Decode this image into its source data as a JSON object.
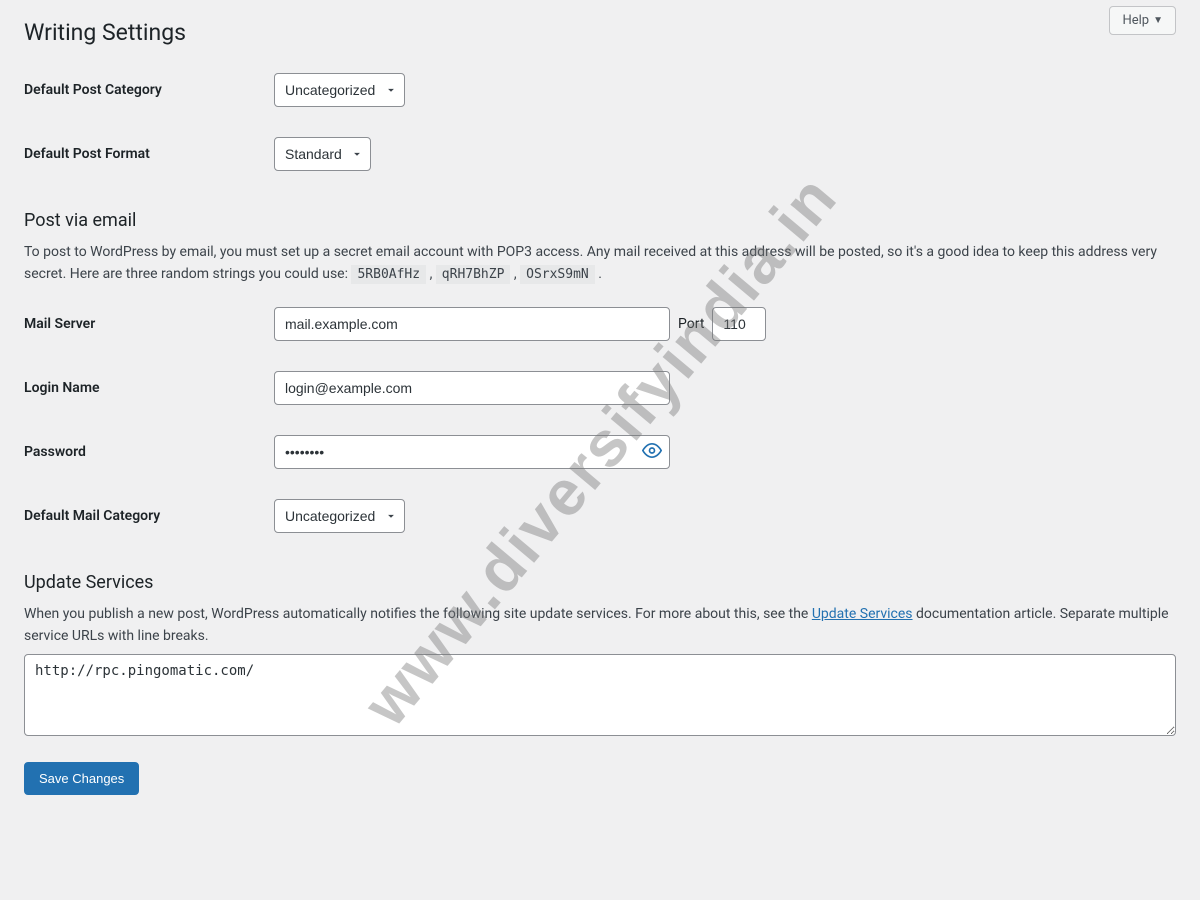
{
  "help": {
    "label": "Help"
  },
  "page": {
    "title": "Writing Settings"
  },
  "fields": {
    "default_category": {
      "label": "Default Post Category",
      "value": "Uncategorized"
    },
    "default_format": {
      "label": "Default Post Format",
      "value": "Standard"
    },
    "mail_server": {
      "label": "Mail Server",
      "value": "mail.example.com"
    },
    "port": {
      "label": "Port",
      "value": "110"
    },
    "login_name": {
      "label": "Login Name",
      "value": "login@example.com"
    },
    "password": {
      "label": "Password",
      "value": "password"
    },
    "mail_category": {
      "label": "Default Mail Category",
      "value": "Uncategorized"
    }
  },
  "sections": {
    "post_email": {
      "title": "Post via email",
      "desc_pre": "To post to WordPress by email, you must set up a secret email account with POP3 access. Any mail received at this address will be posted, so it's a good idea to keep this address very secret. Here are three random strings you could use: ",
      "rand1": "5RB0AfHz",
      "rand2": "qRH7BhZP",
      "rand3": "OSrxS9mN",
      "comma": " , ",
      "period": " ."
    },
    "update_services": {
      "title": "Update Services",
      "desc_pre": "When you publish a new post, WordPress automatically notifies the following site update services. For more about this, see the ",
      "link_text": "Update Services",
      "desc_post": " documentation article. Separate multiple service URLs with line breaks.",
      "textarea_value": "http://rpc.pingomatic.com/"
    }
  },
  "save": {
    "label": "Save Changes"
  },
  "watermark": "www.diversifyindia.in"
}
